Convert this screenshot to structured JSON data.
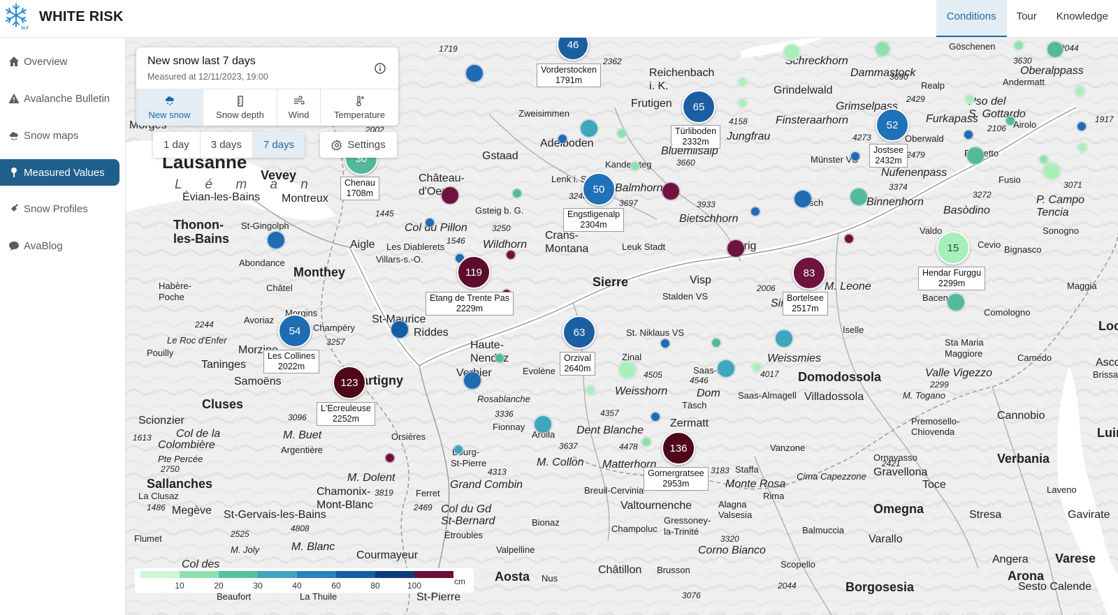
{
  "app": {
    "name": "WHITE RISK"
  },
  "topnav": {
    "items": [
      {
        "label": "Conditions"
      },
      {
        "label": "Tour"
      },
      {
        "label": "Knowledge"
      }
    ]
  },
  "sidebar": {
    "items": [
      {
        "label": "Overview",
        "icon": "home-icon"
      },
      {
        "label": "Avalanche Bulletin",
        "icon": "warning-icon"
      },
      {
        "label": "Snow maps",
        "icon": "snow-cloud-icon"
      },
      {
        "label": "Measured Values",
        "icon": "pin-icon"
      },
      {
        "label": "Snow Profiles",
        "icon": "shovel-icon"
      },
      {
        "label": "AvaBlog",
        "icon": "chat-bubble-icon"
      }
    ]
  },
  "panel": {
    "title": "New snow last 7 days",
    "subtitle": "Measured at 12/11/2023, 19:00",
    "tabs": [
      {
        "label": "New snow",
        "icon": "snowfall-icon"
      },
      {
        "label": "Snow depth",
        "icon": "depth-gauge-icon"
      },
      {
        "label": "Wind",
        "icon": "wind-icon"
      },
      {
        "label": "Temperature",
        "icon": "thermometer-icon"
      }
    ]
  },
  "period": {
    "options": [
      "1 day",
      "3 days",
      "7 days"
    ],
    "selected": "7 days"
  },
  "settings": {
    "label": "Settings"
  },
  "legend": {
    "ticks": [
      "10",
      "20",
      "30",
      "40",
      "60",
      "80",
      "100"
    ],
    "unit": "cm",
    "colors": [
      "#ccf7d5",
      "#8fe0ae",
      "#55c19e",
      "#3ea6bd",
      "#2883be",
      "#145ea6",
      "#0d3c7a",
      "#6a0f3a",
      "#4a0818"
    ]
  },
  "map": {
    "lake_label": "L é m a n",
    "places": [
      {
        "t": "Lausanne",
        "c": "big"
      },
      {
        "t": "Vevey",
        "c": "big"
      },
      {
        "t": "Morges",
        "c": "mid"
      },
      {
        "t": "Montreux",
        "c": "mid"
      },
      {
        "t": "Évian-les-Bains",
        "c": "mid"
      },
      {
        "t": "Thonon-",
        "c": "big"
      },
      {
        "t": "les-Bains",
        "c": "big"
      },
      {
        "t": "St-Gingolph",
        "c": "sm"
      },
      {
        "t": "Abondance",
        "c": "sm"
      },
      {
        "t": "Monthey",
        "c": "big"
      },
      {
        "t": "Habère-",
        "c": "sm"
      },
      {
        "t": "Poche",
        "c": "sm"
      },
      {
        "t": "Châtel",
        "c": "sm"
      },
      {
        "t": "Morgins",
        "c": "sm"
      },
      {
        "t": "Avoriaz",
        "c": "sm"
      },
      {
        "t": "Champéry",
        "c": "sm"
      },
      {
        "t": "Le Roc d'Enfer",
        "c": "sm it"
      },
      {
        "t": "Pouilly",
        "c": "sm"
      },
      {
        "t": "Morzine",
        "c": "mid"
      },
      {
        "t": "Taninges",
        "c": "mid"
      },
      {
        "t": "Samoëns",
        "c": "mid"
      },
      {
        "t": "Cluses",
        "c": "big"
      },
      {
        "t": "Scionzier",
        "c": "mid"
      },
      {
        "t": "Sallanches",
        "c": "big"
      },
      {
        "t": "La Clusaz",
        "c": "sm"
      },
      {
        "t": "Megève",
        "c": "mid"
      },
      {
        "t": "St-Gervais-les-Bains",
        "c": "mid"
      },
      {
        "t": "Flumet",
        "c": "sm"
      },
      {
        "t": "M. Joly",
        "c": "sm it"
      },
      {
        "t": "Col des",
        "c": "mid it"
      },
      {
        "t": "Beaufort",
        "c": "sm"
      },
      {
        "t": "Chamonix-",
        "c": "mid"
      },
      {
        "t": "Mont-Blanc",
        "c": "mid"
      },
      {
        "t": "M. Blanc",
        "c": "mid it"
      },
      {
        "t": "M. Dolent",
        "c": "mid it"
      },
      {
        "t": "Argentière",
        "c": "sm"
      },
      {
        "t": "M. Buet",
        "c": "mid it"
      },
      {
        "t": "Col de la",
        "c": "mid it"
      },
      {
        "t": "Colombière",
        "c": "mid it"
      },
      {
        "t": "Pte Percée",
        "c": "sm it"
      },
      {
        "t": "Courmayeur",
        "c": "mid"
      },
      {
        "t": "La Thuile",
        "c": "sm"
      },
      {
        "t": "Aosta",
        "c": "big"
      },
      {
        "t": "Nus",
        "c": "sm"
      },
      {
        "t": "St-Pierre",
        "c": "mid"
      },
      {
        "t": "Ferret",
        "c": "sm"
      },
      {
        "t": "Orsières",
        "c": "sm"
      },
      {
        "t": "Bourg-",
        "c": "sm"
      },
      {
        "t": "St-Pierre",
        "c": "sm"
      },
      {
        "t": "Fionnay",
        "c": "sm"
      },
      {
        "t": "Rosablanche",
        "c": "sm it"
      },
      {
        "t": "Grand Combin",
        "c": "mid it"
      },
      {
        "t": "Col du Gd",
        "c": "mid it"
      },
      {
        "t": "St-Bernard",
        "c": "mid it"
      },
      {
        "t": "Étroubles",
        "c": "sm"
      },
      {
        "t": "Bionaz",
        "c": "sm"
      },
      {
        "t": "Valpelline",
        "c": "sm"
      },
      {
        "t": "Châtillon",
        "c": "mid"
      },
      {
        "t": "Brusson",
        "c": "sm"
      },
      {
        "t": "St-Maurice",
        "c": "mid"
      },
      {
        "t": "Riddes",
        "c": "mid"
      },
      {
        "t": "Martigny",
        "c": "big"
      },
      {
        "t": "Verbier",
        "c": "mid"
      },
      {
        "t": "Haute-",
        "c": "mid"
      },
      {
        "t": "Nendaz",
        "c": "mid"
      },
      {
        "t": "Evolène",
        "c": "sm"
      },
      {
        "t": "Arolla",
        "c": "sm"
      },
      {
        "t": "M. Collon",
        "c": "mid it"
      },
      {
        "t": "Dent Blanche",
        "c": "mid it"
      },
      {
        "t": "Matterhorn",
        "c": "mid it"
      },
      {
        "t": "Zermatt",
        "c": "mid"
      },
      {
        "t": "Täsch",
        "c": "sm"
      },
      {
        "t": "Weisshorn",
        "c": "mid it"
      },
      {
        "t": "Dom",
        "c": "mid it"
      },
      {
        "t": "Zinal",
        "c": "sm"
      },
      {
        "t": "St. Niklaus VS",
        "c": "sm"
      },
      {
        "t": "Saas-Fee",
        "c": "sm"
      },
      {
        "t": "Saas-Almagell",
        "c": "sm"
      },
      {
        "t": "Sierre",
        "c": "big"
      },
      {
        "t": "Crans-",
        "c": "mid"
      },
      {
        "t": "Montana",
        "c": "mid"
      },
      {
        "t": "Leuk Stadt",
        "c": "sm"
      },
      {
        "t": "Visp",
        "c": "mid"
      },
      {
        "t": "Stalden VS",
        "c": "sm"
      },
      {
        "t": "Brig",
        "c": "mid"
      },
      {
        "t": "Simplon",
        "c": "mid it"
      },
      {
        "t": "M. Leone",
        "c": "mid it"
      },
      {
        "t": "Weissmies",
        "c": "mid it"
      },
      {
        "t": "Domodossola",
        "c": "big"
      },
      {
        "t": "Villadossola",
        "c": "mid"
      },
      {
        "t": "Bietschhorn",
        "c": "mid it"
      },
      {
        "t": "Wildhorn",
        "c": "mid it"
      },
      {
        "t": "Les Diablerets",
        "c": "sm"
      },
      {
        "t": "Villars-s.-O.",
        "c": "sm"
      },
      {
        "t": "Aigle",
        "c": "mid"
      },
      {
        "t": "Col du Pillon",
        "c": "mid it"
      },
      {
        "t": "Château-",
        "c": "mid"
      },
      {
        "t": "d'Oex",
        "c": "mid"
      },
      {
        "t": "Gstaad",
        "c": "mid"
      },
      {
        "t": "Gsteig b. G.",
        "c": "sm"
      },
      {
        "t": "Lenk i. S.",
        "c": "sm"
      },
      {
        "t": "Zweisimmen",
        "c": "sm"
      },
      {
        "t": "Adelboden",
        "c": "mid"
      },
      {
        "t": "Kandersteg",
        "c": "sm"
      },
      {
        "t": "Balmhorn",
        "c": "mid it"
      },
      {
        "t": "Blüemlisalp",
        "c": "mid it"
      },
      {
        "t": "Frutigen",
        "c": "mid"
      },
      {
        "t": "Reichenbach",
        "c": "mid"
      },
      {
        "t": "i. K.",
        "c": "mid"
      },
      {
        "t": "Jungfrau",
        "c": "mid it"
      },
      {
        "t": "Finsteraarhorn",
        "c": "mid it"
      },
      {
        "t": "Grindelwald",
        "c": "mid"
      },
      {
        "t": "Grimselpass",
        "c": "mid it"
      },
      {
        "t": "Furkapass",
        "c": "mid it"
      },
      {
        "t": "Oberwald",
        "c": "sm"
      },
      {
        "t": "Münster VS",
        "c": "sm"
      },
      {
        "t": "Nufenenpass",
        "c": "mid it"
      },
      {
        "t": "Binnenhorn",
        "c": "mid it"
      },
      {
        "t": "Fiesch",
        "c": "sm"
      },
      {
        "t": "Basòdino",
        "c": "mid it"
      },
      {
        "t": "Bedretto",
        "c": "sm"
      },
      {
        "t": "Airolo",
        "c": "sm"
      },
      {
        "t": "Pso del",
        "c": "mid it"
      },
      {
        "t": "S. Gottardo",
        "c": "mid it"
      },
      {
        "t": "Andermatt",
        "c": "sm"
      },
      {
        "t": "Realp",
        "c": "sm"
      },
      {
        "t": "Göschenen",
        "c": "sm"
      },
      {
        "t": "Oberalppass",
        "c": "mid it"
      },
      {
        "t": "Dammastock",
        "c": "mid it"
      },
      {
        "t": "Schreckhorn",
        "c": "mid it"
      },
      {
        "t": "Fusio",
        "c": "sm"
      },
      {
        "t": "P. Campo",
        "c": "mid it"
      },
      {
        "t": "Tencia",
        "c": "mid it"
      },
      {
        "t": "Sonogno",
        "c": "sm"
      },
      {
        "t": "Bignasco",
        "c": "sm"
      },
      {
        "t": "Valdo",
        "c": "sm"
      },
      {
        "t": "Maggia",
        "c": "sm"
      },
      {
        "t": "Cevio",
        "c": "sm"
      },
      {
        "t": "Baceno",
        "c": "sm"
      },
      {
        "t": "Comologno",
        "c": "sm"
      },
      {
        "t": "Iselle",
        "c": "sm"
      },
      {
        "t": "Sta Maria",
        "c": "sm"
      },
      {
        "t": "Maggiore",
        "c": "sm"
      },
      {
        "t": "Camedo",
        "c": "sm"
      },
      {
        "t": "Valle Vigezzo",
        "c": "mid it"
      },
      {
        "t": "M. Togano",
        "c": "sm it"
      },
      {
        "t": "Premosello-",
        "c": "sm"
      },
      {
        "t": "Chiovenda",
        "c": "sm"
      },
      {
        "t": "Cannobio",
        "c": "mid"
      },
      {
        "t": "Verbania",
        "c": "big"
      },
      {
        "t": "Ornavasso",
        "c": "sm"
      },
      {
        "t": "Gravellona",
        "c": "mid"
      },
      {
        "t": "Toce",
        "c": "mid"
      },
      {
        "t": "Omegna",
        "c": "big"
      },
      {
        "t": "Stresa",
        "c": "mid"
      },
      {
        "t": "Varallo",
        "c": "mid"
      },
      {
        "t": "Balmuccia",
        "c": "sm"
      },
      {
        "t": "Rima",
        "c": "sm"
      },
      {
        "t": "Alagna",
        "c": "sm"
      },
      {
        "t": "Valsesia",
        "c": "sm"
      },
      {
        "t": "Gressoney-",
        "c": "sm"
      },
      {
        "t": "la-Trinité",
        "c": "sm"
      },
      {
        "t": "Valtournenche",
        "c": "mid"
      },
      {
        "t": "Breuil-Cervinia",
        "c": "sm"
      },
      {
        "t": "Champoluc",
        "c": "sm"
      },
      {
        "t": "Corno Bianco",
        "c": "mid it"
      },
      {
        "t": "Vanzone",
        "c": "sm"
      },
      {
        "t": "Staffa",
        "c": "sm"
      },
      {
        "t": "Cima Capezzone",
        "c": "sm it"
      },
      {
        "t": "Monte Rosa",
        "c": "mid it"
      },
      {
        "t": "Borgosesia",
        "c": "big"
      },
      {
        "t": "Scopello",
        "c": "sm"
      },
      {
        "t": "Varese",
        "c": "big"
      },
      {
        "t": "Arona",
        "c": "big"
      },
      {
        "t": "Angera",
        "c": "mid"
      },
      {
        "t": "Sesto Calende",
        "c": "mid"
      },
      {
        "t": "Gavirate",
        "c": "mid"
      },
      {
        "t": "Laveno",
        "c": "sm"
      },
      {
        "t": "Luino",
        "c": "big"
      },
      {
        "t": "Locarno",
        "c": "big"
      },
      {
        "t": "Ascona",
        "c": "mid"
      },
      {
        "t": "Brissago",
        "c": "sm"
      }
    ],
    "elevations": [
      "1719",
      "2362",
      "3630",
      "2044",
      "3690",
      "2429",
      "4158",
      "1917",
      "2106",
      "4273",
      "3660",
      "2479",
      "3374",
      "3272",
      "3071",
      "2002",
      "1445",
      "1546",
      "3250",
      "3248",
      "3697",
      "3933",
      "3257",
      "2244",
      "3096",
      "1613",
      "2750",
      "1486",
      "4808",
      "2525",
      "3819",
      "2469",
      "3336",
      "4313",
      "3637",
      "4478",
      "4357",
      "4505",
      "4546",
      "4017",
      "2006",
      "2299",
      "2421",
      "3320",
      "2044",
      "3076",
      "3183"
    ],
    "clusters": [
      {
        "value": "46",
        "color": "#1b5fa3"
      },
      {
        "value": "65",
        "color": "#1b5fa3"
      },
      {
        "value": "52",
        "color": "#1f72b8"
      },
      {
        "value": "50",
        "color": "#1f72b8"
      },
      {
        "value": "30",
        "color": "#52b99c"
      },
      {
        "value": "119",
        "color": "#5c0d2c"
      },
      {
        "value": "83",
        "color": "#6e1340"
      },
      {
        "value": "15",
        "color": "#a6efb8"
      },
      {
        "value": "54",
        "color": "#1f6cb3"
      },
      {
        "value": "63",
        "color": "#1b5fa3"
      },
      {
        "value": "123",
        "color": "#4e0818"
      },
      {
        "value": "136",
        "color": "#4e0818"
      }
    ],
    "stations": [
      {
        "name": "Vorderstocken",
        "elev": "1791m"
      },
      {
        "name": "Türliboden",
        "elev": "2332m"
      },
      {
        "name": "Jostsee",
        "elev": "2432m"
      },
      {
        "name": "Chenau",
        "elev": "1708m"
      },
      {
        "name": "Engstligenalp",
        "elev": "2304m"
      },
      {
        "name": "Hendar Furggu",
        "elev": "2299m"
      },
      {
        "name": "Etang de Trente Pas",
        "elev": "2229m"
      },
      {
        "name": "Bortelsee",
        "elev": "2517m"
      },
      {
        "name": "Les Collines",
        "elev": "2022m"
      },
      {
        "name": "Orzival",
        "elev": "2640m"
      },
      {
        "name": "L'Ecreuleuse",
        "elev": "2252m"
      },
      {
        "name": "Gornergratsee",
        "elev": "2953m"
      }
    ]
  }
}
